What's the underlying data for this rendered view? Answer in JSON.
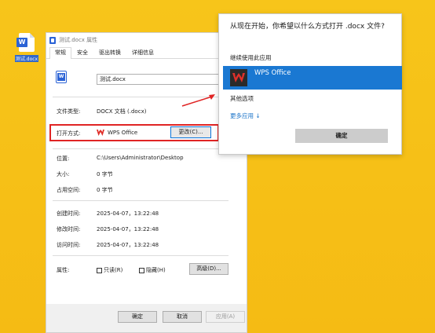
{
  "desktop": {
    "file_label": "测试.docx",
    "file_icon": "word-doc-icon"
  },
  "properties": {
    "title": "测试.docx 属性",
    "tabs": [
      "常规",
      "安全",
      "驱出转换",
      "详细信息"
    ],
    "file_name": "测试.docx",
    "labels": {
      "type": "文件类型:",
      "open_with": "打开方式:",
      "location": "位置:",
      "size": "大小:",
      "size_on_disk": "占用空间:",
      "created": "创建时间:",
      "modified": "修改时间:",
      "accessed": "访问时间:",
      "attributes": "属性:"
    },
    "values": {
      "type": "DOCX 文档 (.docx)",
      "open_with": "WPS Office",
      "location": "C:\\Users\\Administrator\\Desktop",
      "size": "0 字节",
      "size_on_disk": "0 字节",
      "created": "2025-04-07，13:22:48",
      "modified": "2025-04-07，13:22:48",
      "accessed": "2025-04-07，13:22:48"
    },
    "change_button": "更改(C)...",
    "readonly_label": "只读(R)",
    "hidden_label": "隐藏(H)",
    "advanced_button": "高级(D)...",
    "ok_button": "确定",
    "cancel_button": "取消",
    "apply_button": "应用(A)"
  },
  "open_with_dialog": {
    "title": "从现在开始，你希望以什么方式打开 .docx 文件?",
    "keep_using": "继续使用此应用",
    "selected_app": "WPS Office",
    "other_options": "其他选项",
    "more_apps": "更多应用 ↓",
    "ok_button": "确定"
  },
  "colors": {
    "desktop_bg": "#f6c11a",
    "selection_blue": "#1a78d2",
    "highlight_red": "#e02424",
    "wps_red": "#e0302a"
  }
}
